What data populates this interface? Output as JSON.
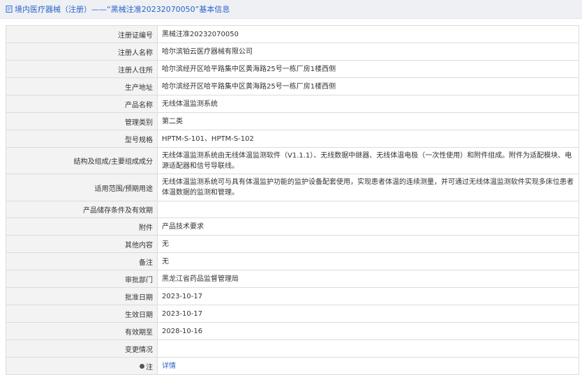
{
  "header": {
    "title": "境内医疗器械（注册）——“黑械注准20232070050”基本信息"
  },
  "rows": [
    {
      "label": "注册证编号",
      "value": "黑械注准20232070050"
    },
    {
      "label": "注册人名称",
      "value": "哈尔滨铂云医疗器械有限公司"
    },
    {
      "label": "注册人住所",
      "value": "哈尔滨经开区哈平路集中区黄海路25号一栋厂房1楼西侧"
    },
    {
      "label": "生产地址",
      "value": "哈尔滨经开区哈平路集中区黄海路25号一栋厂房1楼西侧"
    },
    {
      "label": "产品名称",
      "value": "无线体温监测系统"
    },
    {
      "label": "管理类别",
      "value": "第二类"
    },
    {
      "label": "型号规格",
      "value": "HPTM-S-101、HPTM-S-102"
    },
    {
      "label": "结构及组成/主要组成成分",
      "value": "无线体温监测系统由无线体温监测软件（V1.1.1）、无线数据中继器、无线体温电极（一次性使用）和附件组成。附件为适配模块、电源适配器和信号导联线。"
    },
    {
      "label": "适用范围/预期用途",
      "value": "无线体温监测系统可与具有体温监护功能的监护设备配套使用，实现患者体温的连续测量，并可通过无线体温监测软件实现多床位患者体温数据的监测和管理。"
    },
    {
      "label": "产品储存条件及有效期",
      "value": ""
    },
    {
      "label": "附件",
      "value": "产品技术要求"
    },
    {
      "label": "其他内容",
      "value": "无"
    },
    {
      "label": "备注",
      "value": "无"
    },
    {
      "label": "审批部门",
      "value": "黑龙江省药品监督管理局"
    },
    {
      "label": "批准日期",
      "value": "2023-10-17"
    },
    {
      "label": "生效日期",
      "value": "2023-10-17"
    },
    {
      "label": "有效期至",
      "value": "2028-10-16"
    },
    {
      "label": "变更情况",
      "value": ""
    },
    {
      "label": "注",
      "value": "详情",
      "icon": "pin-icon"
    }
  ]
}
